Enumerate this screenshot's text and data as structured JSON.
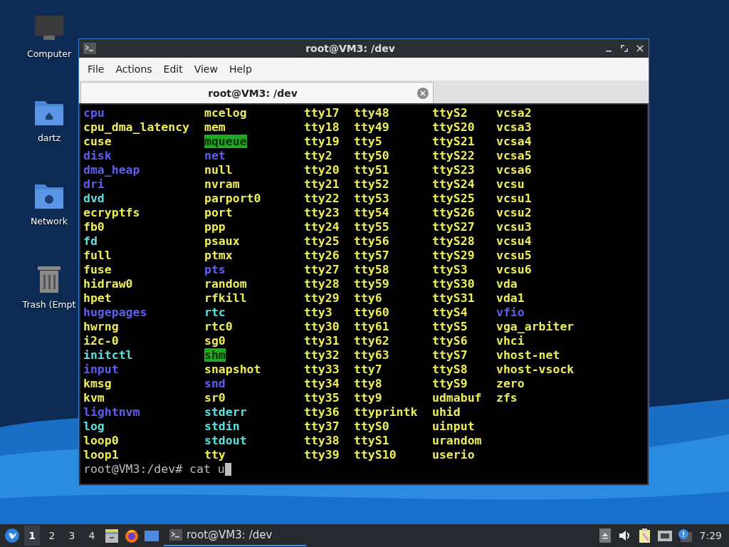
{
  "desktop_icons": [
    {
      "label": "Computer",
      "kind": "computer"
    },
    {
      "label": "dartz",
      "kind": "home"
    },
    {
      "label": "Network",
      "kind": "network"
    },
    {
      "label": "Trash (Empt",
      "kind": "trash"
    }
  ],
  "window": {
    "title": "root@VM3: /dev",
    "menu": [
      "File",
      "Actions",
      "Edit",
      "View",
      "Help"
    ],
    "tabs": [
      {
        "label": "root@VM3: /dev",
        "selected": true
      }
    ],
    "terminal": {
      "columns": [
        {
          "entries": [
            {
              "name": "cpu",
              "kind": "dir"
            },
            {
              "name": "cpu_dma_latency",
              "kind": "dev"
            },
            {
              "name": "cuse",
              "kind": "dev"
            },
            {
              "name": "disk",
              "kind": "dir"
            },
            {
              "name": "dma_heap",
              "kind": "dir"
            },
            {
              "name": "dri",
              "kind": "dir"
            },
            {
              "name": "dvd",
              "kind": "link"
            },
            {
              "name": "ecryptfs",
              "kind": "dev"
            },
            {
              "name": "fb0",
              "kind": "dev"
            },
            {
              "name": "fd",
              "kind": "link"
            },
            {
              "name": "full",
              "kind": "dev"
            },
            {
              "name": "fuse",
              "kind": "dev"
            },
            {
              "name": "hidraw0",
              "kind": "dev"
            },
            {
              "name": "hpet",
              "kind": "dev"
            },
            {
              "name": "hugepages",
              "kind": "dir"
            },
            {
              "name": "hwrng",
              "kind": "dev"
            },
            {
              "name": "i2c-0",
              "kind": "dev"
            },
            {
              "name": "initctl",
              "kind": "link"
            },
            {
              "name": "input",
              "kind": "dir"
            },
            {
              "name": "kmsg",
              "kind": "dev"
            },
            {
              "name": "kvm",
              "kind": "dev"
            },
            {
              "name": "lightnvm",
              "kind": "dir"
            },
            {
              "name": "log",
              "kind": "link"
            },
            {
              "name": "loop0",
              "kind": "dev"
            },
            {
              "name": "loop1",
              "kind": "dev"
            }
          ]
        },
        {
          "entries": [
            {
              "name": "mcelog",
              "kind": "dev"
            },
            {
              "name": "mem",
              "kind": "dev"
            },
            {
              "name": "mqueue",
              "kind": "sticky"
            },
            {
              "name": "net",
              "kind": "dir"
            },
            {
              "name": "null",
              "kind": "dev"
            },
            {
              "name": "nvram",
              "kind": "dev"
            },
            {
              "name": "parport0",
              "kind": "dev"
            },
            {
              "name": "port",
              "kind": "dev"
            },
            {
              "name": "ppp",
              "kind": "dev"
            },
            {
              "name": "psaux",
              "kind": "dev"
            },
            {
              "name": "ptmx",
              "kind": "dev"
            },
            {
              "name": "pts",
              "kind": "dir"
            },
            {
              "name": "random",
              "kind": "dev"
            },
            {
              "name": "rfkill",
              "kind": "dev"
            },
            {
              "name": "rtc",
              "kind": "link"
            },
            {
              "name": "rtc0",
              "kind": "dev"
            },
            {
              "name": "sg0",
              "kind": "dev"
            },
            {
              "name": "shm",
              "kind": "sticky"
            },
            {
              "name": "snapshot",
              "kind": "dev"
            },
            {
              "name": "snd",
              "kind": "dir"
            },
            {
              "name": "sr0",
              "kind": "dev"
            },
            {
              "name": "stderr",
              "kind": "link"
            },
            {
              "name": "stdin",
              "kind": "link"
            },
            {
              "name": "stdout",
              "kind": "link"
            },
            {
              "name": "tty",
              "kind": "dev"
            }
          ]
        },
        {
          "entries": [
            {
              "name": "tty17",
              "kind": "dev"
            },
            {
              "name": "tty18",
              "kind": "dev"
            },
            {
              "name": "tty19",
              "kind": "dev"
            },
            {
              "name": "tty2",
              "kind": "dev"
            },
            {
              "name": "tty20",
              "kind": "dev"
            },
            {
              "name": "tty21",
              "kind": "dev"
            },
            {
              "name": "tty22",
              "kind": "dev"
            },
            {
              "name": "tty23",
              "kind": "dev"
            },
            {
              "name": "tty24",
              "kind": "dev"
            },
            {
              "name": "tty25",
              "kind": "dev"
            },
            {
              "name": "tty26",
              "kind": "dev"
            },
            {
              "name": "tty27",
              "kind": "dev"
            },
            {
              "name": "tty28",
              "kind": "dev"
            },
            {
              "name": "tty29",
              "kind": "dev"
            },
            {
              "name": "tty3",
              "kind": "dev"
            },
            {
              "name": "tty30",
              "kind": "dev"
            },
            {
              "name": "tty31",
              "kind": "dev"
            },
            {
              "name": "tty32",
              "kind": "dev"
            },
            {
              "name": "tty33",
              "kind": "dev"
            },
            {
              "name": "tty34",
              "kind": "dev"
            },
            {
              "name": "tty35",
              "kind": "dev"
            },
            {
              "name": "tty36",
              "kind": "dev"
            },
            {
              "name": "tty37",
              "kind": "dev"
            },
            {
              "name": "tty38",
              "kind": "dev"
            },
            {
              "name": "tty39",
              "kind": "dev"
            }
          ]
        },
        {
          "entries": [
            {
              "name": "tty48",
              "kind": "dev"
            },
            {
              "name": "tty49",
              "kind": "dev"
            },
            {
              "name": "tty5",
              "kind": "dev"
            },
            {
              "name": "tty50",
              "kind": "dev"
            },
            {
              "name": "tty51",
              "kind": "dev"
            },
            {
              "name": "tty52",
              "kind": "dev"
            },
            {
              "name": "tty53",
              "kind": "dev"
            },
            {
              "name": "tty54",
              "kind": "dev"
            },
            {
              "name": "tty55",
              "kind": "dev"
            },
            {
              "name": "tty56",
              "kind": "dev"
            },
            {
              "name": "tty57",
              "kind": "dev"
            },
            {
              "name": "tty58",
              "kind": "dev"
            },
            {
              "name": "tty59",
              "kind": "dev"
            },
            {
              "name": "tty6",
              "kind": "dev"
            },
            {
              "name": "tty60",
              "kind": "dev"
            },
            {
              "name": "tty61",
              "kind": "dev"
            },
            {
              "name": "tty62",
              "kind": "dev"
            },
            {
              "name": "tty63",
              "kind": "dev"
            },
            {
              "name": "tty7",
              "kind": "dev"
            },
            {
              "name": "tty8",
              "kind": "dev"
            },
            {
              "name": "tty9",
              "kind": "dev"
            },
            {
              "name": "ttyprintk",
              "kind": "dev"
            },
            {
              "name": "ttyS0",
              "kind": "dev"
            },
            {
              "name": "ttyS1",
              "kind": "dev"
            },
            {
              "name": "ttyS10",
              "kind": "dev"
            }
          ]
        },
        {
          "entries": [
            {
              "name": "ttyS2",
              "kind": "dev"
            },
            {
              "name": "ttyS20",
              "kind": "dev"
            },
            {
              "name": "ttyS21",
              "kind": "dev"
            },
            {
              "name": "ttyS22",
              "kind": "dev"
            },
            {
              "name": "ttyS23",
              "kind": "dev"
            },
            {
              "name": "ttyS24",
              "kind": "dev"
            },
            {
              "name": "ttyS25",
              "kind": "dev"
            },
            {
              "name": "ttyS26",
              "kind": "dev"
            },
            {
              "name": "ttyS27",
              "kind": "dev"
            },
            {
              "name": "ttyS28",
              "kind": "dev"
            },
            {
              "name": "ttyS29",
              "kind": "dev"
            },
            {
              "name": "ttyS3",
              "kind": "dev"
            },
            {
              "name": "ttyS30",
              "kind": "dev"
            },
            {
              "name": "ttyS31",
              "kind": "dev"
            },
            {
              "name": "ttyS4",
              "kind": "dev"
            },
            {
              "name": "ttyS5",
              "kind": "dev"
            },
            {
              "name": "ttyS6",
              "kind": "dev"
            },
            {
              "name": "ttyS7",
              "kind": "dev"
            },
            {
              "name": "ttyS8",
              "kind": "dev"
            },
            {
              "name": "ttyS9",
              "kind": "dev"
            },
            {
              "name": "udmabuf",
              "kind": "dev"
            },
            {
              "name": "uhid",
              "kind": "dev"
            },
            {
              "name": "uinput",
              "kind": "dev"
            },
            {
              "name": "urandom",
              "kind": "dev"
            },
            {
              "name": "userio",
              "kind": "dev"
            }
          ]
        },
        {
          "entries": [
            {
              "name": "vcsa2",
              "kind": "dev"
            },
            {
              "name": "vcsa3",
              "kind": "dev"
            },
            {
              "name": "vcsa4",
              "kind": "dev"
            },
            {
              "name": "vcsa5",
              "kind": "dev"
            },
            {
              "name": "vcsa6",
              "kind": "dev"
            },
            {
              "name": "vcsu",
              "kind": "dev"
            },
            {
              "name": "vcsu1",
              "kind": "dev"
            },
            {
              "name": "vcsu2",
              "kind": "dev"
            },
            {
              "name": "vcsu3",
              "kind": "dev"
            },
            {
              "name": "vcsu4",
              "kind": "dev"
            },
            {
              "name": "vcsu5",
              "kind": "dev"
            },
            {
              "name": "vcsu6",
              "kind": "dev"
            },
            {
              "name": "vda",
              "kind": "dev"
            },
            {
              "name": "vda1",
              "kind": "dev"
            },
            {
              "name": "vfio",
              "kind": "dir"
            },
            {
              "name": "vga_arbiter",
              "kind": "dev"
            },
            {
              "name": "vhci",
              "kind": "dev"
            },
            {
              "name": "vhost-net",
              "kind": "dev"
            },
            {
              "name": "vhost-vsock",
              "kind": "dev"
            },
            {
              "name": "zero",
              "kind": "dev"
            },
            {
              "name": "zfs",
              "kind": "dev"
            }
          ]
        }
      ],
      "prompt": "root@VM3:/dev# cat u"
    }
  },
  "taskbar": {
    "workspaces": [
      {
        "label": "1",
        "selected": true
      },
      {
        "label": "2",
        "selected": false
      },
      {
        "label": "3",
        "selected": false
      },
      {
        "label": "4",
        "selected": false
      }
    ],
    "launchers": [
      {
        "kind": "files"
      },
      {
        "kind": "browser"
      },
      {
        "kind": "desktop"
      }
    ],
    "tasks": [
      {
        "label": "root@VM3: /dev",
        "selected": true
      }
    ],
    "clock": "7:29"
  }
}
